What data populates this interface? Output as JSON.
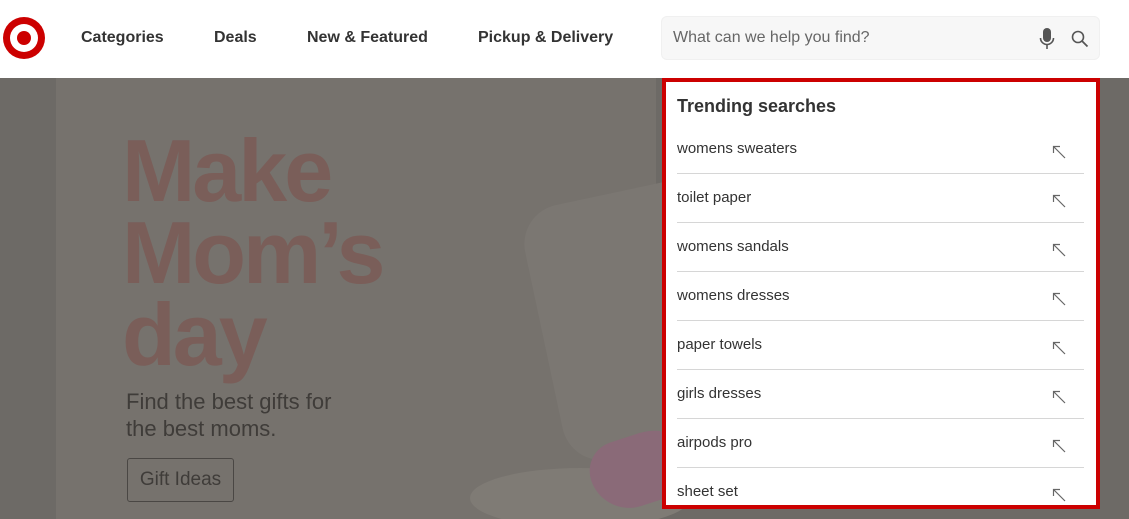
{
  "header": {
    "logo_icon": "target-bullseye-logo",
    "brand_color": "#cc0000",
    "nav": [
      {
        "label": "Categories"
      },
      {
        "label": "Deals"
      },
      {
        "label": "New & Featured"
      },
      {
        "label": "Pickup & Delivery"
      }
    ],
    "search": {
      "placeholder": "What can we help you find?",
      "value": "",
      "mic_icon": "microphone-icon",
      "search_icon": "search-icon"
    }
  },
  "hero": {
    "headline_lines": [
      "Make",
      "Mom’s",
      "day"
    ],
    "subtext_lines": [
      "Find the best gifts for",
      "the best moms."
    ],
    "cta_label": "Gift Ideas"
  },
  "trending": {
    "title": "Trending searches",
    "highlight_color": "#cc0000",
    "arrow_icon": "arrow-up-left-icon",
    "items": [
      {
        "label": "womens sweaters"
      },
      {
        "label": "toilet paper"
      },
      {
        "label": "womens sandals"
      },
      {
        "label": "womens dresses"
      },
      {
        "label": "paper towels"
      },
      {
        "label": "girls dresses"
      },
      {
        "label": "airpods pro"
      },
      {
        "label": "sheet set"
      }
    ]
  }
}
